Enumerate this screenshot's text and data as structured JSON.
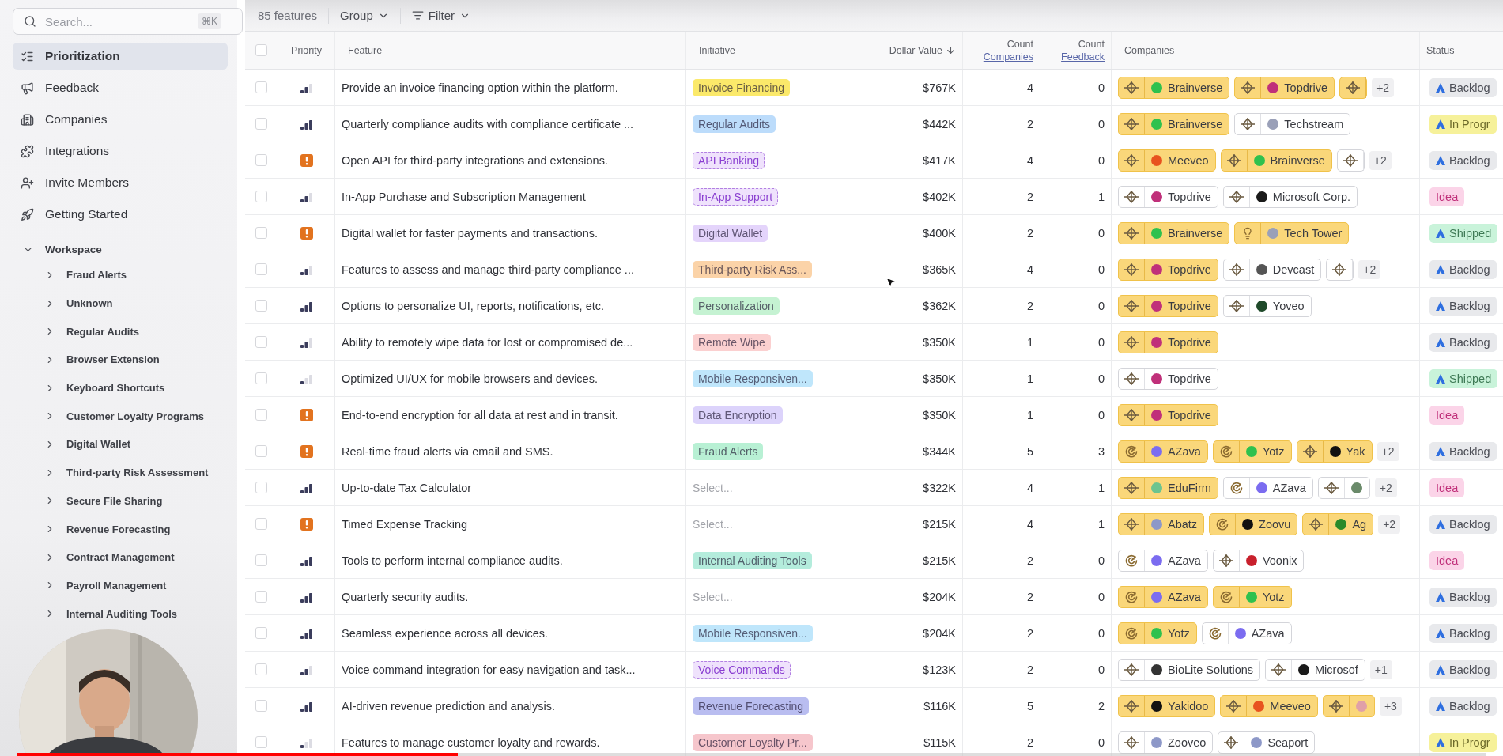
{
  "sidebar": {
    "search": {
      "placeholder": "Search...",
      "shortcut": "⌘K"
    },
    "nav": [
      {
        "label": "Prioritization",
        "selected": true
      },
      {
        "label": "Feedback",
        "selected": false
      },
      {
        "label": "Companies",
        "selected": false
      },
      {
        "label": "Integrations",
        "selected": false
      },
      {
        "label": "Invite Members",
        "selected": false
      },
      {
        "label": "Getting Started",
        "selected": false
      }
    ],
    "workspace": {
      "label": "Workspace",
      "expanded": true,
      "children": [
        {
          "label": "Fraud Alerts",
          "expanded": false
        },
        {
          "label": "Unknown",
          "expanded": false
        },
        {
          "label": "Regular Audits",
          "expanded": false
        },
        {
          "label": "Browser Extension",
          "expanded": false
        },
        {
          "label": "Keyboard Shortcuts",
          "expanded": false
        },
        {
          "label": "Customer Loyalty Programs",
          "expanded": false
        },
        {
          "label": "Digital Wallet",
          "expanded": false
        },
        {
          "label": "Third-party Risk Assessment",
          "expanded": false
        },
        {
          "label": "Secure File Sharing",
          "expanded": false
        },
        {
          "label": "Revenue Forecasting",
          "expanded": false
        },
        {
          "label": "Contract Management",
          "expanded": false
        },
        {
          "label": "Payroll Management",
          "expanded": false
        },
        {
          "label": "Internal Auditing Tools",
          "expanded": false
        }
      ]
    }
  },
  "toolbar": {
    "count": "85 features",
    "group": "Group",
    "filter": "Filter"
  },
  "table": {
    "header_checked": false,
    "columns": [
      {
        "label": "Priority"
      },
      {
        "label": "Feature"
      },
      {
        "label": "Initiative"
      },
      {
        "label": "Dollar Value",
        "sorted": true
      },
      {
        "label": "Count",
        "sublabel": "Companies"
      },
      {
        "label": "Count",
        "sublabel": "Feedback"
      },
      {
        "label": "Companies"
      },
      {
        "label": "Status"
      }
    ],
    "rows": [
      {
        "checked": false,
        "priority": {
          "kind": "medium"
        },
        "feature": "Provide an invoice financing option within the platform.",
        "initiative": {
          "label": "Invoice Financing",
          "color": "#fbe96a",
          "dashed": false
        },
        "dollar": "$767K",
        "count_companies": "4",
        "count_feedback": "0",
        "companies": {
          "chips": [
            {
              "kind": "crosshair",
              "highlighted": true,
              "color": "#2fc14e",
              "name": "Brainverse"
            },
            {
              "kind": "crosshair",
              "highlighted": true,
              "color": "#c0307a",
              "name": "Topdrive"
            },
            {
              "kind": "crosshair",
              "highlighted": true
            }
          ],
          "more": "+2"
        },
        "status": {
          "label": "Backlog",
          "kind": "backlog"
        }
      },
      {
        "checked": false,
        "priority": {
          "kind": "high"
        },
        "feature": "Quarterly compliance audits with compliance certificate ...",
        "initiative": {
          "label": "Regular Audits",
          "color": "#bcdcfb",
          "dashed": false
        },
        "dollar": "$442K",
        "count_companies": "2",
        "count_feedback": "0",
        "companies": {
          "chips": [
            {
              "kind": "crosshair",
              "highlighted": true,
              "color": "#2fc14e",
              "name": "Brainverse"
            },
            {
              "kind": "crosshair",
              "highlighted": false,
              "color": "#9aa0b8",
              "name": "Techstream"
            }
          ]
        },
        "status": {
          "label": "In Progr",
          "kind": "progress"
        }
      },
      {
        "checked": false,
        "priority": {
          "kind": "urgent"
        },
        "feature": "Open API for third-party integrations and extensions.",
        "initiative": {
          "label": "API Banking",
          "color": "#efe2fc",
          "dashed": true
        },
        "dollar": "$417K",
        "count_companies": "4",
        "count_feedback": "0",
        "companies": {
          "chips": [
            {
              "kind": "crosshair",
              "highlighted": true,
              "color": "#e8531f",
              "name": "Meeveo"
            },
            {
              "kind": "crosshair",
              "highlighted": true,
              "color": "#2fc14e",
              "name": "Brainverse"
            },
            {
              "kind": "crosshair",
              "highlighted": false
            }
          ],
          "more": "+2"
        },
        "status": {
          "label": "Backlog",
          "kind": "backlog"
        }
      },
      {
        "checked": false,
        "priority": {
          "kind": "medium"
        },
        "feature": "In-App Purchase and Subscription Management",
        "initiative": {
          "label": "In-App Support",
          "color": "#efe2fc",
          "dashed": true
        },
        "dollar": "$402K",
        "count_companies": "2",
        "count_feedback": "1",
        "companies": {
          "chips": [
            {
              "kind": "crosshair",
              "highlighted": false,
              "color": "#c0307a",
              "name": "Topdrive"
            },
            {
              "kind": "crosshair",
              "highlighted": false,
              "color": "#1a1a1a",
              "name": "Microsoft Corp."
            }
          ]
        },
        "status": {
          "label": "Idea",
          "kind": "idea"
        }
      },
      {
        "checked": false,
        "priority": {
          "kind": "urgent"
        },
        "feature": "Digital wallet for faster payments and transactions.",
        "initiative": {
          "label": "Digital Wallet",
          "color": "#e4d4fb",
          "dashed": false
        },
        "dollar": "$400K",
        "count_companies": "2",
        "count_feedback": "0",
        "companies": {
          "chips": [
            {
              "kind": "crosshair",
              "highlighted": true,
              "color": "#2fc14e",
              "name": "Brainverse"
            },
            {
              "kind": "bulb",
              "highlighted": true,
              "color": "#9aa0b8",
              "name": "Tech Tower"
            }
          ]
        },
        "status": {
          "label": "Shipped",
          "kind": "shipped"
        }
      },
      {
        "checked": false,
        "priority": {
          "kind": "medium"
        },
        "feature": "Features to assess and manage third-party compliance ...",
        "initiative": {
          "label": "Third-party Risk Ass...",
          "color": "#fbd3a8",
          "dashed": false
        },
        "dollar": "$365K",
        "count_companies": "4",
        "count_feedback": "0",
        "companies": {
          "chips": [
            {
              "kind": "crosshair",
              "highlighted": true,
              "color": "#c0307a",
              "name": "Topdrive"
            },
            {
              "kind": "crosshair",
              "highlighted": false,
              "color": "#555555",
              "name": "Devcast"
            },
            {
              "kind": "crosshair",
              "highlighted": false
            }
          ],
          "more": "+2"
        },
        "status": {
          "label": "Backlog",
          "kind": "backlog"
        }
      },
      {
        "checked": false,
        "priority": {
          "kind": "high"
        },
        "feature": "Options to personalize UI, reports, notifications, etc.",
        "initiative": {
          "label": "Personalization",
          "color": "#c5f2d2",
          "dashed": false
        },
        "dollar": "$362K",
        "count_companies": "2",
        "count_feedback": "0",
        "companies": {
          "chips": [
            {
              "kind": "crosshair",
              "highlighted": true,
              "color": "#c0307a",
              "name": "Topdrive"
            },
            {
              "kind": "crosshair",
              "highlighted": false,
              "color": "#1f4a2a",
              "name": "Yoveo"
            }
          ]
        },
        "status": {
          "label": "Backlog",
          "kind": "backlog"
        }
      },
      {
        "checked": false,
        "priority": {
          "kind": "medium"
        },
        "feature": "Ability to remotely wipe data for lost or compromised de...",
        "initiative": {
          "label": "Remote Wipe",
          "color": "#fbd0d0",
          "dashed": false
        },
        "dollar": "$350K",
        "count_companies": "1",
        "count_feedback": "0",
        "companies": {
          "chips": [
            {
              "kind": "crosshair",
              "highlighted": true,
              "color": "#c0307a",
              "name": "Topdrive"
            }
          ]
        },
        "status": {
          "label": "Backlog",
          "kind": "backlog"
        }
      },
      {
        "checked": false,
        "priority": {
          "kind": "low"
        },
        "feature": "Optimized UI/UX for mobile browsers and devices.",
        "initiative": {
          "label": "Mobile Responsiven...",
          "color": "#bfe6fb",
          "dashed": false
        },
        "dollar": "$350K",
        "count_companies": "1",
        "count_feedback": "0",
        "companies": {
          "chips": [
            {
              "kind": "crosshair",
              "highlighted": false,
              "color": "#c0307a",
              "name": "Topdrive"
            }
          ]
        },
        "status": {
          "label": "Shipped",
          "kind": "shipped"
        }
      },
      {
        "checked": false,
        "priority": {
          "kind": "urgent"
        },
        "feature": "End-to-end encryption for all data at rest and in transit.",
        "initiative": {
          "label": "Data Encryption",
          "color": "#dcd3fb",
          "dashed": false
        },
        "dollar": "$350K",
        "count_companies": "1",
        "count_feedback": "0",
        "companies": {
          "chips": [
            {
              "kind": "crosshair",
              "highlighted": true,
              "color": "#c0307a",
              "name": "Topdrive"
            }
          ]
        },
        "status": {
          "label": "Idea",
          "kind": "idea"
        }
      },
      {
        "checked": false,
        "priority": {
          "kind": "urgent"
        },
        "feature": "Real-time fraud alerts via email and SMS.",
        "initiative": {
          "label": "Fraud Alerts",
          "color": "#b8f0d4",
          "dashed": false
        },
        "dollar": "$344K",
        "count_companies": "5",
        "count_feedback": "3",
        "companies": {
          "chips": [
            {
              "kind": "swirl",
              "highlighted": true,
              "color": "#7b6cf0",
              "name": "AZava"
            },
            {
              "kind": "swirl",
              "highlighted": true,
              "color": "#2fc14e",
              "name": "Yotz"
            },
            {
              "kind": "crosshair",
              "highlighted": true,
              "color": "#111111",
              "name": "Yak"
            }
          ],
          "more": "+2"
        },
        "status": {
          "label": "Backlog",
          "kind": "backlog"
        }
      },
      {
        "checked": false,
        "priority": {
          "kind": "high"
        },
        "feature": "Up-to-date Tax Calculator",
        "initiative": {
          "placeholder": "Select..."
        },
        "dollar": "$322K",
        "count_companies": "4",
        "count_feedback": "1",
        "companies": {
          "chips": [
            {
              "kind": "crosshair",
              "highlighted": true,
              "color": "#6cc48f",
              "name": "EduFirm"
            },
            {
              "kind": "swirl",
              "highlighted": false,
              "color": "#7b6cf0",
              "name": "AZava"
            },
            {
              "kind": "crosshair",
              "highlighted": false,
              "color": "#6a8a6a"
            }
          ],
          "more": "+2"
        },
        "status": {
          "label": "Idea",
          "kind": "idea"
        }
      },
      {
        "checked": false,
        "priority": {
          "kind": "urgent"
        },
        "feature": "Timed Expense Tracking",
        "initiative": {
          "placeholder": "Select..."
        },
        "dollar": "$215K",
        "count_companies": "4",
        "count_feedback": "1",
        "companies": {
          "chips": [
            {
              "kind": "crosshair",
              "highlighted": true,
              "color": "#8d98c8",
              "name": "Abatz"
            },
            {
              "kind": "swirl",
              "highlighted": true,
              "color": "#111111",
              "name": "Zoovu"
            },
            {
              "kind": "crosshair",
              "highlighted": true,
              "color": "#2a8a2a",
              "name": "Ag"
            }
          ],
          "more": "+2"
        },
        "status": {
          "label": "Backlog",
          "kind": "backlog"
        }
      },
      {
        "checked": false,
        "priority": {
          "kind": "high"
        },
        "feature": "Tools to perform internal compliance audits.",
        "initiative": {
          "label": "Internal Auditing Tools",
          "color": "#b4ecdc",
          "dashed": false
        },
        "dollar": "$215K",
        "count_companies": "2",
        "count_feedback": "0",
        "companies": {
          "chips": [
            {
              "kind": "swirl",
              "highlighted": false,
              "color": "#7b6cf0",
              "name": "AZava"
            },
            {
              "kind": "crosshair",
              "highlighted": false,
              "color": "#c8202c",
              "name": "Voonix"
            }
          ]
        },
        "status": {
          "label": "Idea",
          "kind": "idea"
        }
      },
      {
        "checked": false,
        "priority": {
          "kind": "high"
        },
        "feature": "Quarterly security audits.",
        "initiative": {
          "placeholder": "Select..."
        },
        "dollar": "$204K",
        "count_companies": "2",
        "count_feedback": "0",
        "companies": {
          "chips": [
            {
              "kind": "swirl",
              "highlighted": true,
              "color": "#7b6cf0",
              "name": "AZava"
            },
            {
              "kind": "swirl",
              "highlighted": true,
              "color": "#2fc14e",
              "name": "Yotz"
            }
          ]
        },
        "status": {
          "label": "Backlog",
          "kind": "backlog"
        }
      },
      {
        "checked": false,
        "priority": {
          "kind": "high"
        },
        "feature": "Seamless experience across all devices.",
        "initiative": {
          "label": "Mobile Responsiven...",
          "color": "#bfe6fb",
          "dashed": false
        },
        "dollar": "$204K",
        "count_companies": "2",
        "count_feedback": "0",
        "companies": {
          "chips": [
            {
              "kind": "swirl",
              "highlighted": true,
              "color": "#2fc14e",
              "name": "Yotz"
            },
            {
              "kind": "swirl",
              "highlighted": false,
              "color": "#7b6cf0",
              "name": "AZava"
            }
          ]
        },
        "status": {
          "label": "Backlog",
          "kind": "backlog"
        }
      },
      {
        "checked": false,
        "priority": {
          "kind": "medium"
        },
        "feature": "Voice command integration for easy navigation and task...",
        "initiative": {
          "label": "Voice Commands",
          "color": "#efe2fc",
          "dashed": true
        },
        "dollar": "$123K",
        "count_companies": "2",
        "count_feedback": "0",
        "companies": {
          "chips": [
            {
              "kind": "crosshair",
              "highlighted": false,
              "color": "#333333",
              "name": "BioLite Solutions"
            },
            {
              "kind": "crosshair",
              "highlighted": false,
              "color": "#1a1a1a",
              "name": "Microsof"
            }
          ],
          "more": "+1"
        },
        "status": {
          "label": "Backlog",
          "kind": "backlog"
        }
      },
      {
        "checked": false,
        "priority": {
          "kind": "high"
        },
        "feature": "AI-driven revenue prediction and analysis.",
        "initiative": {
          "label": "Revenue Forecasting",
          "color": "#b9bdf0",
          "dashed": false
        },
        "dollar": "$116K",
        "count_companies": "5",
        "count_feedback": "2",
        "companies": {
          "chips": [
            {
              "kind": "crosshair",
              "highlighted": true,
              "color": "#111111",
              "name": "Yakidoo"
            },
            {
              "kind": "crosshair",
              "highlighted": true,
              "color": "#e8531f",
              "name": "Meeveo"
            },
            {
              "kind": "crosshair",
              "highlighted": true,
              "color": "#e0a0a8"
            }
          ],
          "more": "+3"
        },
        "status": {
          "label": "Backlog",
          "kind": "backlog"
        }
      },
      {
        "checked": false,
        "priority": {
          "kind": "low"
        },
        "feature": "Features to manage customer loyalty and rewards.",
        "initiative": {
          "label": "Customer Loyalty Pr...",
          "color": "#f6c6cc",
          "dashed": false
        },
        "dollar": "$115K",
        "count_companies": "2",
        "count_feedback": "0",
        "companies": {
          "chips": [
            {
              "kind": "crosshair",
              "highlighted": false,
              "color": "#8d98c8",
              "name": "Zooveo"
            },
            {
              "kind": "crosshair",
              "highlighted": false,
              "color": "#8d98c8",
              "name": "Seaport"
            }
          ]
        },
        "status": {
          "label": "In Progr",
          "kind": "progress"
        }
      }
    ]
  },
  "video_progress": {
    "level": 0.3
  }
}
